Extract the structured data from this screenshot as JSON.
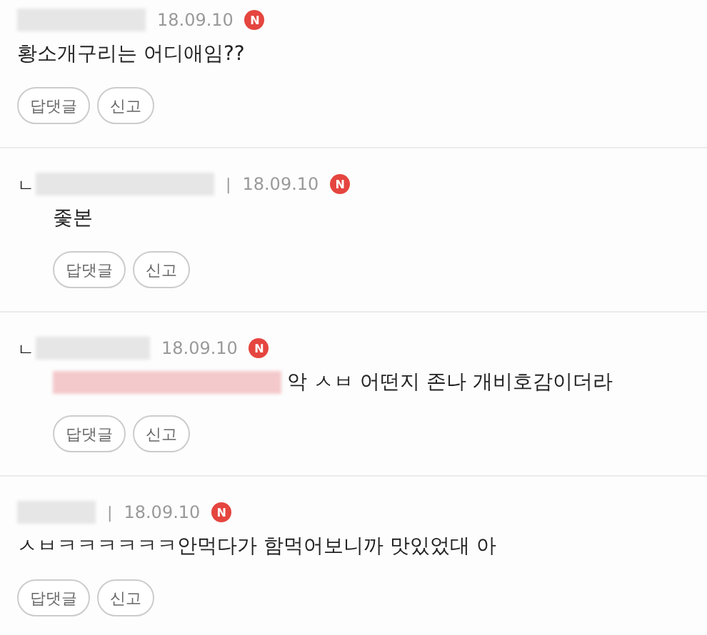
{
  "comments": [
    {
      "date": "18.09.10",
      "new_badge": "N",
      "mention_redacted": false,
      "body": "황소개구리는 어디애임??",
      "buttons": [
        "답댓글",
        "신고"
      ]
    },
    {
      "reply_mark": "ㄴ",
      "separator": "|",
      "date": "18.09.10",
      "new_badge": "N",
      "mention_redacted": false,
      "body": "좇본",
      "buttons": [
        "답댓글",
        "신고"
      ]
    },
    {
      "reply_mark": "ㄴ",
      "date": "18.09.10",
      "new_badge": "N",
      "mention_redacted": true,
      "body": "악 ㅅㅂ 어떤지 존나 개비호감이더라",
      "buttons": [
        "답댓글",
        "신고"
      ]
    },
    {
      "separator": "|",
      "date": "18.09.10",
      "new_badge": "N",
      "mention_redacted": false,
      "body": "ㅅㅂㅋㅋㅋㅋㅋㅋ안먹다가 함먹어보니까 맛있었대 아",
      "buttons": [
        "답댓글",
        "신고"
      ]
    }
  ]
}
